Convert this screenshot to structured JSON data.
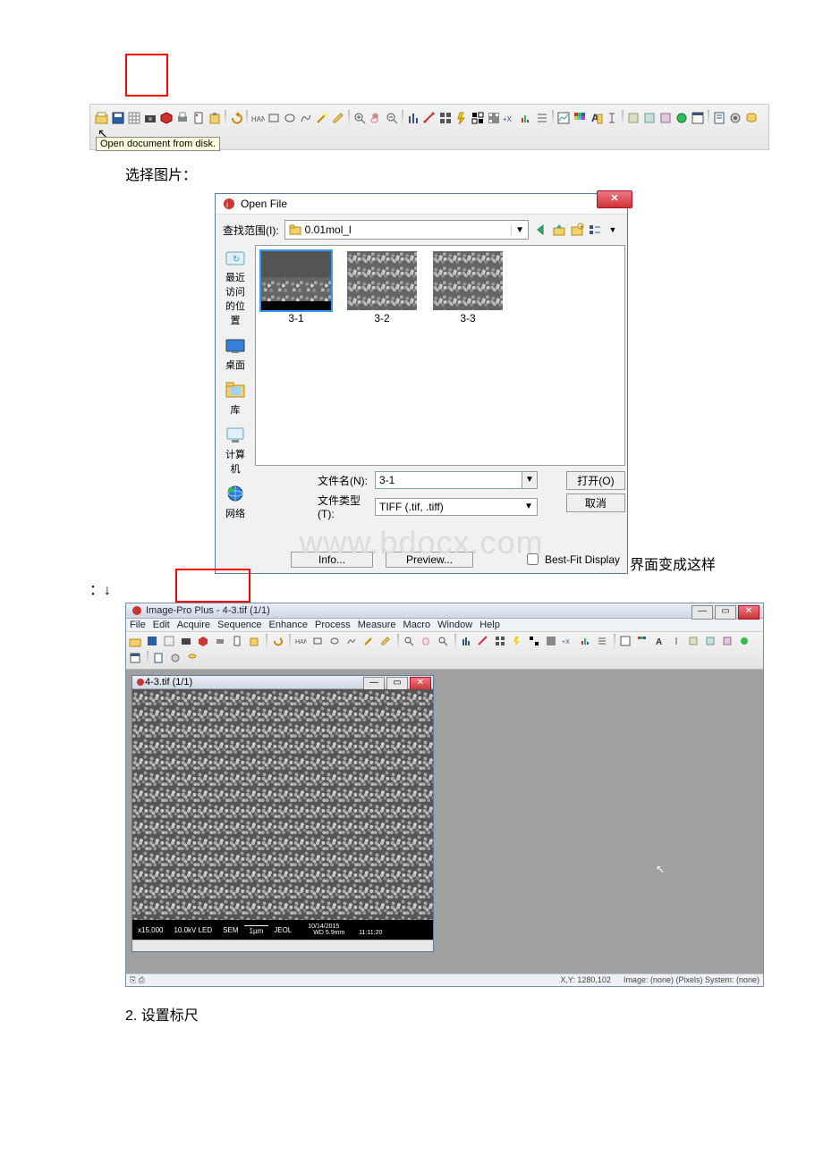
{
  "toolbar_tooltip": "Open document from disk.",
  "caption1": "选择图片：",
  "dialog": {
    "title": "Open File",
    "look_label": "查找范围(I):",
    "look_value": "0.01mol_l",
    "places": {
      "recent": "最近访问的位\n置",
      "desktop": "桌面",
      "lib": "库",
      "computer": "计算机",
      "network": "网络"
    },
    "thumbs": [
      "3-1",
      "3-2",
      "3-3"
    ],
    "fn_label": "文件名(N):",
    "fn_value": "3-1",
    "ft_label": "文件类型(T):",
    "ft_value": "TIFF (.tif, .tiff)",
    "open_btn": "打开(O)",
    "cancel_btn": "取消",
    "info_btn": "Info...",
    "preview_btn": "Preview...",
    "bestfit": "Best-Fit Display",
    "watermark": "www.bdocx.com"
  },
  "after_dialog": "界面变成这样",
  "cont": "：↓",
  "app": {
    "title": "Image-Pro Plus - 4-3.tif (1/1)",
    "menu": [
      "File",
      "Edit",
      "Acquire",
      "Sequence",
      "Enhance",
      "Process",
      "Measure",
      "Macro",
      "Window",
      "Help"
    ],
    "doc_title": "4-3.tif (1/1)",
    "sembar": {
      "mag": "x15,000",
      "kv": "10.0kV LED",
      "sem": "SEM",
      "scale": "1µm",
      "inst": "JEOL",
      "date": "10/14/2015",
      "wd": "WD 5.9mm",
      "time": "11:11:20"
    },
    "status_xy": "X,Y: 1280,102",
    "status_img": "Image: (none) (Pixels) System: (none)"
  },
  "step2": "2. 设置标尺"
}
